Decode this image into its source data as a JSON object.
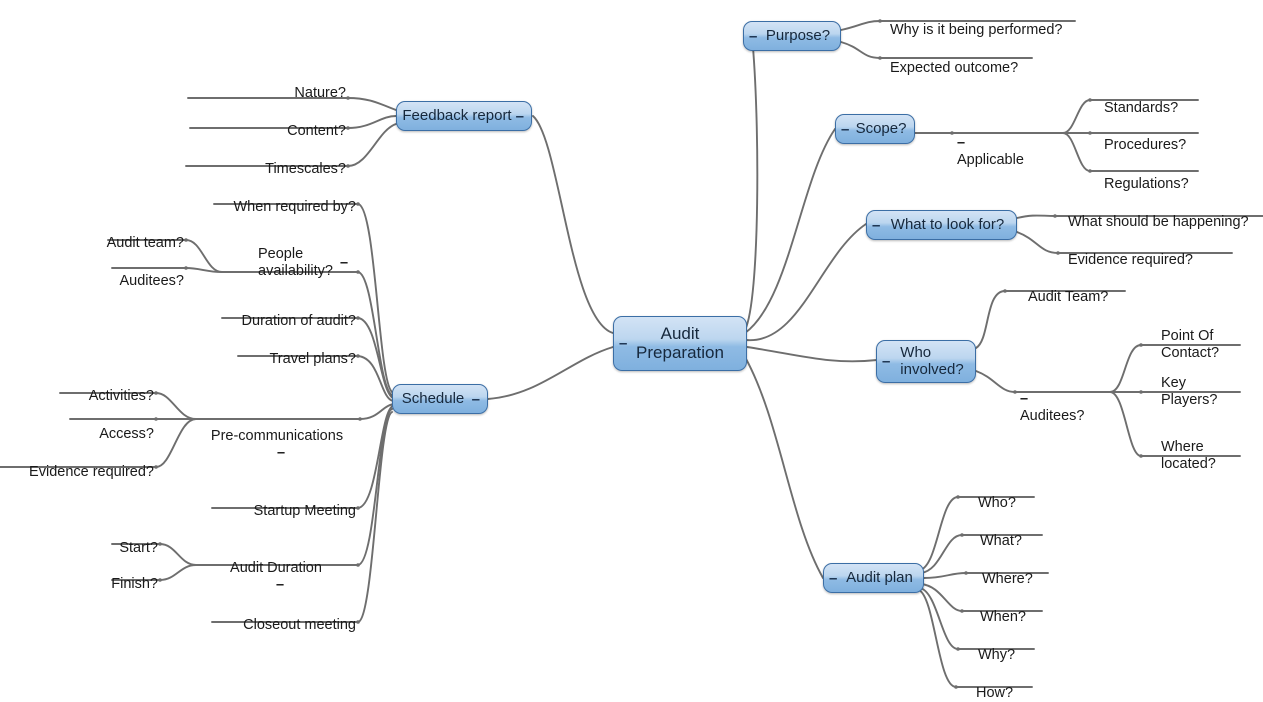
{
  "mindmap": {
    "title": "Audit Preparation",
    "accent_color": "#7fb0de",
    "border_color": "#3b6ea5",
    "line_color": "#6e6e6e",
    "collapse_glyph": "–",
    "root": {
      "label": "Audit\nPreparation"
    },
    "right_branches": [
      {
        "label": "Purpose?",
        "children": [
          {
            "label": "Why is it being performed?"
          },
          {
            "label": "Expected outcome?"
          }
        ]
      },
      {
        "label": "Scope?",
        "children": [
          {
            "label": "Applicable",
            "children": [
              {
                "label": "Standards?"
              },
              {
                "label": "Procedures?"
              },
              {
                "label": "Regulations?"
              }
            ]
          }
        ]
      },
      {
        "label": "What to look for?",
        "children": [
          {
            "label": "What should be happening?"
          },
          {
            "label": "Evidence required?"
          }
        ]
      },
      {
        "label": "Who\ninvolved?",
        "children": [
          {
            "label": "Audit Team?"
          },
          {
            "label": "Auditees?",
            "children": [
              {
                "label": "Point Of\nContact?"
              },
              {
                "label": "Key\nPlayers?"
              },
              {
                "label": "Where\nlocated?"
              }
            ]
          }
        ]
      },
      {
        "label": "Audit plan",
        "children": [
          {
            "label": "Who?"
          },
          {
            "label": "What?"
          },
          {
            "label": "Where?"
          },
          {
            "label": "When?"
          },
          {
            "label": "Why?"
          },
          {
            "label": "How?"
          }
        ]
      }
    ],
    "left_branches": [
      {
        "label": "Feedback report",
        "children": [
          {
            "label": "Nature?"
          },
          {
            "label": "Content?"
          },
          {
            "label": "Timescales?"
          }
        ]
      },
      {
        "label": "Schedule",
        "children": [
          {
            "label": "When required by?"
          },
          {
            "label": "People\navailability?",
            "children": [
              {
                "label": "Audit team?"
              },
              {
                "label": "Auditees?"
              }
            ]
          },
          {
            "label": "Duration of audit?"
          },
          {
            "label": "Travel plans?"
          },
          {
            "label": "Pre-communications",
            "children": [
              {
                "label": "Activities?"
              },
              {
                "label": "Access?"
              },
              {
                "label": "Evidence required?"
              }
            ]
          },
          {
            "label": "Startup Meeting"
          },
          {
            "label": "Audit Duration",
            "children": [
              {
                "label": "Start?"
              },
              {
                "label": "Finish?"
              }
            ]
          },
          {
            "label": "Closeout meeting"
          }
        ]
      }
    ]
  }
}
